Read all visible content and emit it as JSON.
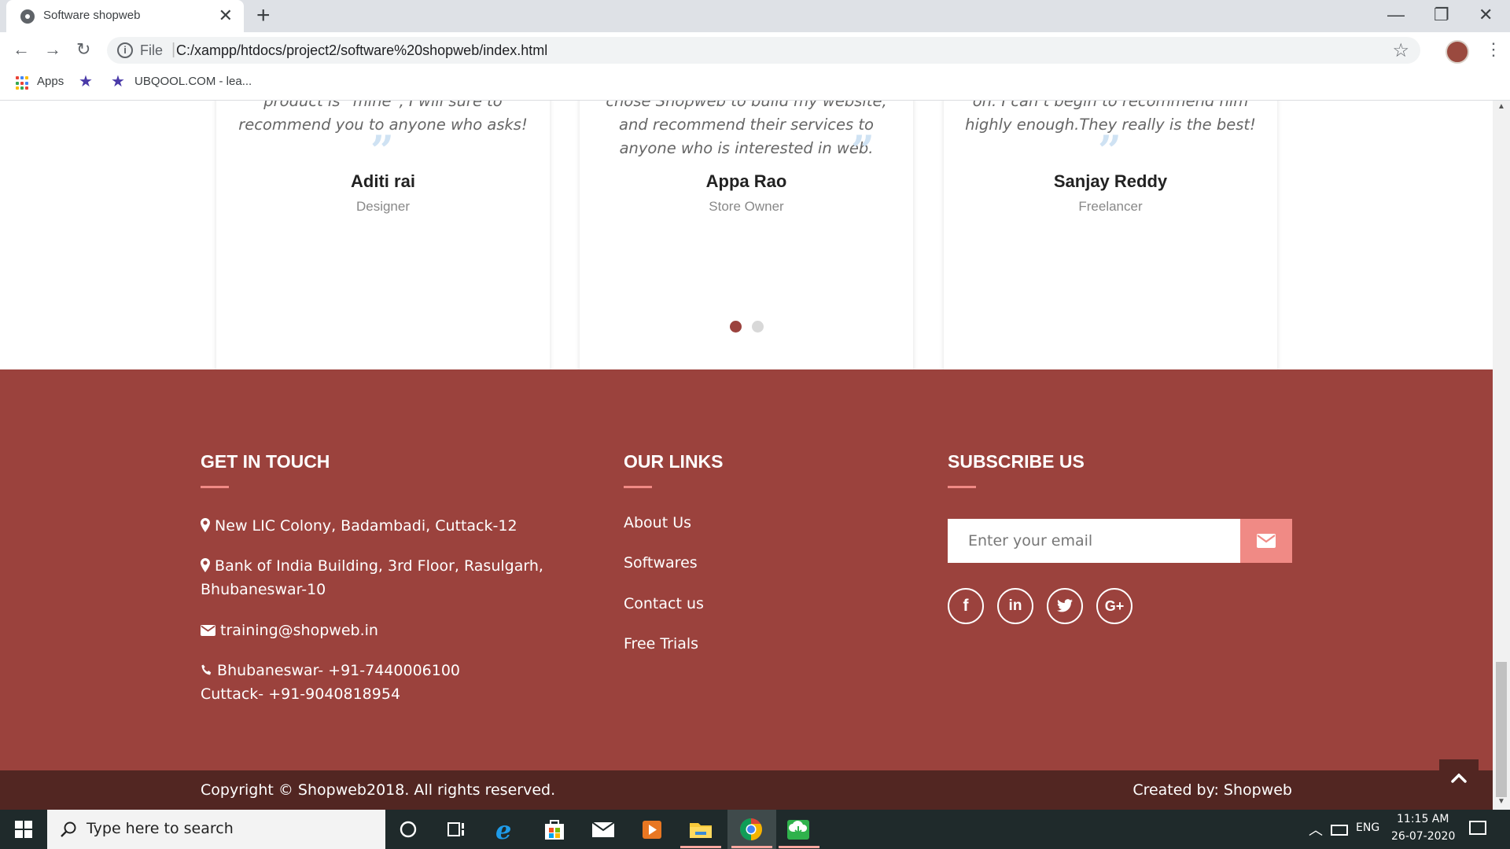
{
  "browser": {
    "tab_title": "Software shopweb",
    "tab_close": "✕",
    "new_tab": "+",
    "window_controls": [
      "—",
      "❐",
      "✕"
    ],
    "nav": {
      "back": "←",
      "forward": "→",
      "reload": "↻"
    },
    "address": {
      "scheme_label": "File",
      "url": "C:/xampp/htdocs/project2/software%20shopweb/index.html"
    },
    "bookmarks": {
      "apps_label": "Apps",
      "item_label": "UBQOOL.COM - lea..."
    }
  },
  "testimonials": [
    {
      "quote_lines": [
        "product is “mine”, I will sure to",
        "recommend you to anyone who asks!"
      ],
      "name": "Aditi rai",
      "role": "Designer"
    },
    {
      "quote_lines": [
        "chose Shopweb to build my website,",
        "and recommend their services to",
        "anyone who is interested in web."
      ],
      "name": "Appa Rao",
      "role": "Store Owner"
    },
    {
      "quote_lines": [
        "on. I can’t begin to recommend him",
        "highly enough.They really is the best!"
      ],
      "name": "Sanjay Reddy",
      "role": "Freelancer"
    }
  ],
  "carousel": {
    "dot_count": 2,
    "active_index": 0
  },
  "footer": {
    "contact": {
      "heading": "GET IN TOUCH",
      "address1": "New LIC Colony, Badambadi, Cuttack-12",
      "address2_line1": "Bank of India Building, 3rd Floor, Rasulgarh,",
      "address2_line2": "Bhubaneswar-10",
      "email": "training@shopweb.in",
      "phone1": "Bhubaneswar- +91-7440006100",
      "phone2": "Cuttack- +91-9040818954"
    },
    "links": {
      "heading": "OUR LINKS",
      "items": [
        "About Us",
        "Softwares",
        "Contact us",
        "Free Trials"
      ]
    },
    "subscribe": {
      "heading": "SUBSCRIBE US",
      "placeholder": "Enter your email",
      "social": [
        "f",
        "in",
        "t",
        "G+"
      ]
    },
    "copyright": "Copyright © Shopweb2018. All rights reserved.",
    "created_by": "Created by: Shopweb"
  },
  "taskbar": {
    "search_placeholder": "Type here to search",
    "language": "ENG",
    "time": "11:15 AM",
    "date": "26-07-2020"
  },
  "colors": {
    "footer_bg": "#9b423d",
    "bottom_bar_bg": "#522622",
    "accent_pink": "#f08a85",
    "carousel_active": "#9b423d",
    "carousel_inactive": "#d8d8d8"
  },
  "icons": [
    "globe-icon",
    "close-icon",
    "plus-icon",
    "minimize-icon",
    "restore-icon",
    "back-arrow-icon",
    "forward-arrow-icon",
    "reload-icon",
    "info-icon",
    "bookmark-star-icon",
    "profile-avatar",
    "kebab-menu-icon",
    "apps-grid-icon",
    "map-marker-icon",
    "envelope-icon",
    "phone-icon",
    "facebook-icon",
    "linkedin-icon",
    "twitter-icon",
    "google-plus-icon",
    "chevron-up-icon",
    "windows-start-icon",
    "search-icon",
    "cortana-icon",
    "task-view-icon",
    "edge-icon",
    "store-icon",
    "mail-icon",
    "media-player-icon",
    "file-explorer-icon",
    "chrome-icon",
    "download-icon",
    "battery-icon",
    "notification-icon"
  ]
}
